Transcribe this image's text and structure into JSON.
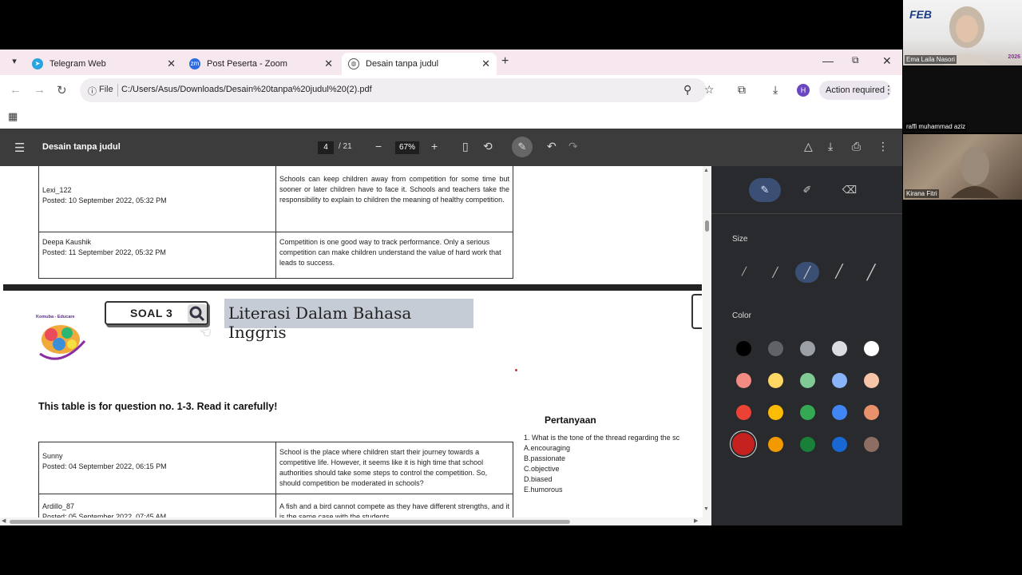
{
  "browser": {
    "tabs": [
      {
        "label": "Telegram Web",
        "icon": "telegram-icon",
        "color": "#2aa3df"
      },
      {
        "label": "Post Peserta - Zoom",
        "icon": "zoom-icon",
        "color": "#2d6cdf"
      },
      {
        "label": "Desain tanpa judul",
        "icon": "globe-icon",
        "color": "#555555"
      }
    ],
    "address": {
      "scheme_label": "File",
      "url": "C:/Users/Asus/Downloads/Desain%20tanpa%20judul%20(2).pdf"
    },
    "profile_initial": "H",
    "action_label": "Action required"
  },
  "pdf": {
    "doc_title": "Desain tanpa judul",
    "page_current": "4",
    "page_total": "/ 21",
    "zoom": "67%"
  },
  "doc": {
    "table_top": [
      {
        "author": "Lexi_122",
        "posted": "Posted: 10 September 2022, 05:32 PM",
        "comment": "Schools can keep children away from competition for some time but sooner or later children have to face it. Schools and teachers take the responsibility to explain to children the meaning of healthy competition."
      },
      {
        "author": "Deepa Kaushik",
        "posted": "Posted: 11 September 2022, 05:32 PM",
        "comment": "Competition is one good way to track performance. Only a serious competition can make children understand the value of hard work that leads to success."
      }
    ],
    "soal_label": "SOAL 3",
    "title": "Literasi Dalam Bahasa Inggris",
    "logo_text": "Komuba - Educare",
    "instruction": "This table is for question no. 1-3. Read it carefully!",
    "table_bottom": [
      {
        "author": "Sunny",
        "posted": "Posted: 04 September 2022, 06:15 PM",
        "comment": "School is the place where children start their journey towards a competitive life. However, it seems like it is high time that school authorities should take some steps to control the competition. So, should competition be moderated in schools?"
      },
      {
        "author": "Ardillo_87",
        "posted": "Posted: 05 September 2022, 07:45 AM",
        "comment": "A fish and a bird cannot compete as they have different strengths, and it is the same case with the students."
      }
    ],
    "questions_title": "Pertanyaan",
    "question_1": "1. What is the tone of the thread regarding the sc",
    "options": [
      "A.encouraging",
      "B.passionate",
      "C.objective",
      "D.biased",
      "E.humorous"
    ]
  },
  "annotate": {
    "size_label": "Size",
    "color_label": "Color",
    "colors": [
      [
        "#000000",
        "#5f6368",
        "#9aa0a6",
        "#dadce0",
        "#ffffff"
      ],
      [
        "#f28b82",
        "#fdd663",
        "#81c995",
        "#8ab4f8",
        "#f6c5a8"
      ],
      [
        "#ea4335",
        "#fbbc04",
        "#34a853",
        "#4285f4",
        "#e8916b"
      ],
      [
        "#c5221f",
        "#f29900",
        "#188038",
        "#1967d2",
        "#8d6e63"
      ]
    ],
    "selected_color": "#c5221f"
  },
  "zoom": {
    "participants": [
      {
        "name": "Ema Laila Nasori",
        "banner": "FEB",
        "year": "2026"
      },
      {
        "name": "raffi muhammad aziz"
      },
      {
        "name": "Kirana Fitri"
      }
    ]
  }
}
